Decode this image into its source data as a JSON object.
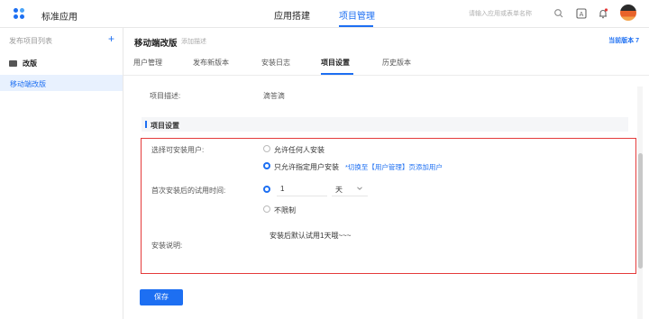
{
  "header": {
    "app_title": "标准应用",
    "nav": [
      "应用搭建",
      "项目管理"
    ],
    "search_placeholder": "请输入应用或表单名称",
    "search_icon": "search-icon",
    "icons": [
      "app-switch-icon",
      "bell-icon"
    ],
    "accent": "#1d6ff2"
  },
  "sidebar": {
    "title": "发布项目列表",
    "add_icon": "+",
    "folder": "改版",
    "items": [
      {
        "label": "移动端改版"
      }
    ]
  },
  "main": {
    "project_name": "移动端改版",
    "project_sub": "添加描述",
    "version": "当前版本 7",
    "tabs": [
      "用户管理",
      "发布新版本",
      "安装日志",
      "项目设置",
      "历史版本"
    ],
    "active_tab": "项目设置"
  },
  "form": {
    "desc_label": "项目描述:",
    "desc_value": "滴答滴",
    "section_title": "项目设置",
    "install_users_label": "选择可安装用户:",
    "install_options": [
      "允许任何人安装",
      "只允许指定用户安装"
    ],
    "install_selected": "只允许指定用户安装",
    "install_link": "*切换至【用户管理】页添加用户",
    "trial_label": "首次安装后的试用时间:",
    "trial_value": "1",
    "trial_unit": "天",
    "trial_unlimited": "不限制",
    "note_label": "安装说明:",
    "note_value": "安装后默认试用1天哦~~~",
    "highlight_color": "#e43b3b"
  },
  "footer": {
    "save_label": "保存"
  }
}
